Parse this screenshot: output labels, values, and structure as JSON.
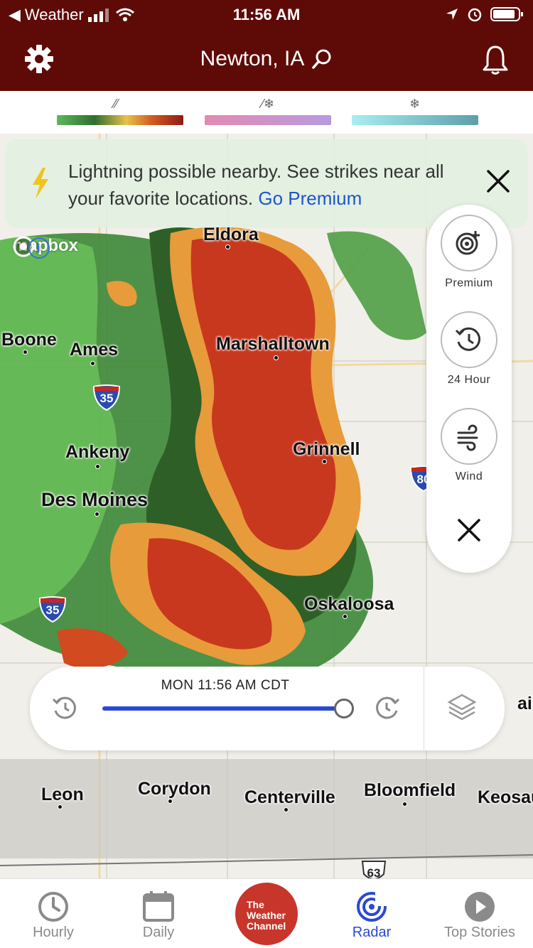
{
  "status_bar": {
    "back_app": "Weather",
    "time": "11:56 AM"
  },
  "header": {
    "location": "Newton, IA"
  },
  "legend": [
    {
      "type": "rain",
      "icon": "raindrop-icon",
      "colors": [
        "#4caa4e",
        "#2d6b2d",
        "#e8c24a",
        "#b8211f"
      ]
    },
    {
      "type": "mix",
      "icon": "mix-icon",
      "colors": [
        "#e48ab2",
        "#b89ae0"
      ]
    },
    {
      "type": "snow",
      "icon": "snowflake-icon",
      "colors": [
        "#9ee6ec",
        "#5fa0ad"
      ]
    }
  ],
  "banner": {
    "message": "Lightning possible nearby. See strikes near all your favorite locations.",
    "link": "Go Premium"
  },
  "map": {
    "attribution": "mapbox",
    "cities": [
      "Eldora",
      "Boone",
      "Ames",
      "Marshalltown",
      "Ankeny",
      "Grinnell",
      "Des Moines",
      "Oskaloosa",
      "Leon",
      "Corydon",
      "Centerville",
      "Bloomfield",
      "Keosau",
      "airfie"
    ],
    "highway_shields": [
      "35",
      "35",
      "80",
      "63"
    ]
  },
  "side_controls": [
    {
      "label": "Premium",
      "icon": "radar-plus-icon"
    },
    {
      "label": "24 Hour",
      "icon": "clock-rewind-icon"
    },
    {
      "label": "Wind",
      "icon": "wind-icon"
    }
  ],
  "timeline": {
    "time_label": "MON 11:56 AM CDT",
    "progress": 1.0
  },
  "tabs": [
    {
      "label": "Hourly",
      "icon": "clock-icon"
    },
    {
      "label": "Daily",
      "icon": "calendar-icon"
    },
    {
      "label": "The Weather Channel",
      "icon": "twc-logo"
    },
    {
      "label": "Radar",
      "icon": "radar-icon",
      "active": true
    },
    {
      "label": "Top Stories",
      "icon": "play-icon"
    }
  ],
  "colors": {
    "header_bg": "#5e0b07",
    "accent": "#2a49d2",
    "link": "#1f56c9"
  }
}
